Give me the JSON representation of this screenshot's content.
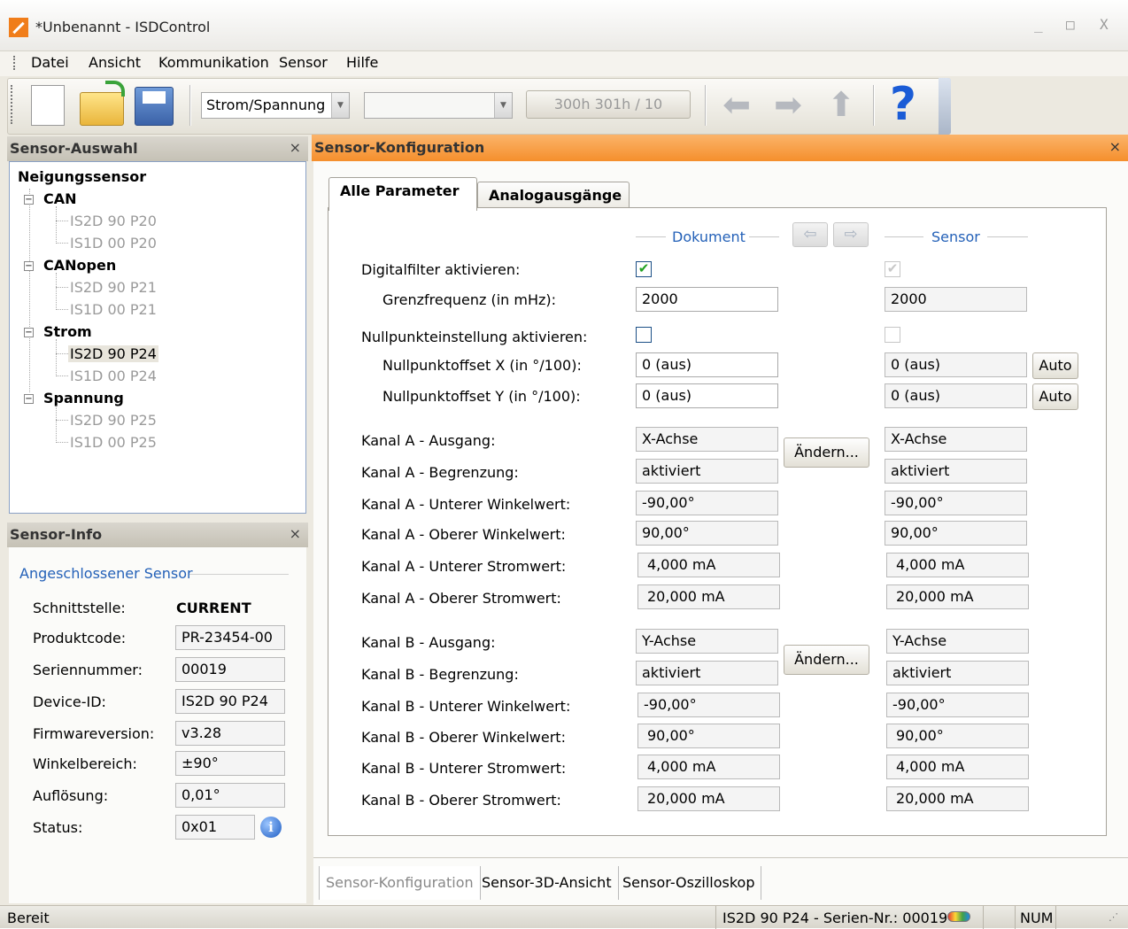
{
  "window": {
    "title": "*Unbenannt - ISDControl",
    "min": "_",
    "max": "□",
    "close": "X"
  },
  "menu": [
    "Datei",
    "Ansicht",
    "Kommunikation",
    "Sensor",
    "Hilfe"
  ],
  "toolbar": {
    "combo1": "Strom/Spannung",
    "combo2": "",
    "id_button": "300h 301h / 10",
    "help": "?"
  },
  "sensor_selection": {
    "title": "Sensor-Auswahl",
    "close": "×",
    "root": "Neigungssensor",
    "groups": [
      {
        "name": "CAN",
        "items": [
          "IS2D 90 P20",
          "IS1D 00 P20"
        ]
      },
      {
        "name": "CANopen",
        "items": [
          "IS2D 90 P21",
          "IS1D 00 P21"
        ]
      },
      {
        "name": "Strom",
        "items": [
          "IS2D 90 P24",
          "IS1D 00 P24"
        ]
      },
      {
        "name": "Spannung",
        "items": [
          "IS2D 90 P25",
          "IS1D 00 P25"
        ]
      }
    ],
    "selected": "IS2D 90 P24"
  },
  "sensor_info": {
    "title": "Sensor-Info",
    "close": "×",
    "section": "Angeschlossener Sensor",
    "rows": [
      {
        "label": "Schnittstelle:",
        "value": "CURRENT"
      },
      {
        "label": "Produktcode:",
        "value": "PR-23454-00"
      },
      {
        "label": "Seriennummer:",
        "value": "00019"
      },
      {
        "label": "Device-ID:",
        "value": "IS2D 90 P24"
      },
      {
        "label": "Firmwareversion:",
        "value": "v3.28"
      },
      {
        "label": "Winkelbereich:",
        "value": "±90°"
      },
      {
        "label": "Auflösung:",
        "value": "0,01°"
      },
      {
        "label": "Status:",
        "value": "0x01"
      }
    ]
  },
  "config": {
    "title": "Sensor-Konfiguration",
    "close": "×",
    "tabs": [
      "Alle Parameter",
      "Analogausgänge"
    ],
    "col_document": "Dokument",
    "col_sensor": "Sensor",
    "digitalfilter_label": "Digitalfilter aktivieren:",
    "grenz_label": "Grenzfrequenz (in mHz):",
    "grenz_doc": "2000",
    "grenz_sensor": "2000",
    "nullpunkt_label": "Nullpunkteinstellung aktivieren:",
    "offx_label": "Nullpunktoffset X (in °/100):",
    "offx_doc": "0 (aus)",
    "offx_sensor": "0 (aus)",
    "offy_label": "Nullpunktoffset Y (in °/100):",
    "offy_doc": "0 (aus)",
    "offy_sensor": "0 (aus)",
    "auto": "Auto",
    "aendern": "Ändern...",
    "kanal_a": [
      {
        "label": "Kanal A - Ausgang:",
        "doc": "X-Achse",
        "sensor": "X-Achse"
      },
      {
        "label": "Kanal A - Begrenzung:",
        "doc": "aktiviert",
        "sensor": "aktiviert"
      },
      {
        "label": "Kanal A - Unterer Winkelwert:",
        "doc": "-90,00°",
        "sensor": "-90,00°"
      },
      {
        "label": "Kanal A - Oberer Winkelwert:",
        "doc": "90,00°",
        "sensor": "90,00°"
      },
      {
        "label": "Kanal A - Unterer Stromwert:",
        "doc": "4,000 mA",
        "sensor": "4,000 mA"
      },
      {
        "label": "Kanal A - Oberer Stromwert:",
        "doc": "20,000 mA",
        "sensor": "20,000 mA"
      }
    ],
    "kanal_b": [
      {
        "label": "Kanal B - Ausgang:",
        "doc": "Y-Achse",
        "sensor": "Y-Achse"
      },
      {
        "label": "Kanal B - Begrenzung:",
        "doc": "aktiviert",
        "sensor": "aktiviert"
      },
      {
        "label": "Kanal B - Unterer Winkelwert:",
        "doc": "-90,00°",
        "sensor": "-90,00°"
      },
      {
        "label": "Kanal B - Oberer Winkelwert:",
        "doc": "90,00°",
        "sensor": "90,00°"
      },
      {
        "label": "Kanal B - Unterer Stromwert:",
        "doc": "4,000 mA",
        "sensor": "4,000 mA"
      },
      {
        "label": "Kanal B - Oberer Stromwert:",
        "doc": "20,000 mA",
        "sensor": "20,000 mA"
      }
    ]
  },
  "bottom_tabs": [
    "Sensor-Konfiguration",
    "Sensor-3D-Ansicht",
    "Sensor-Oszilloskop"
  ],
  "status": {
    "left": "Bereit",
    "device": "IS2D 90 P24 - Serien-Nr.: 00019",
    "num": "NUM"
  }
}
